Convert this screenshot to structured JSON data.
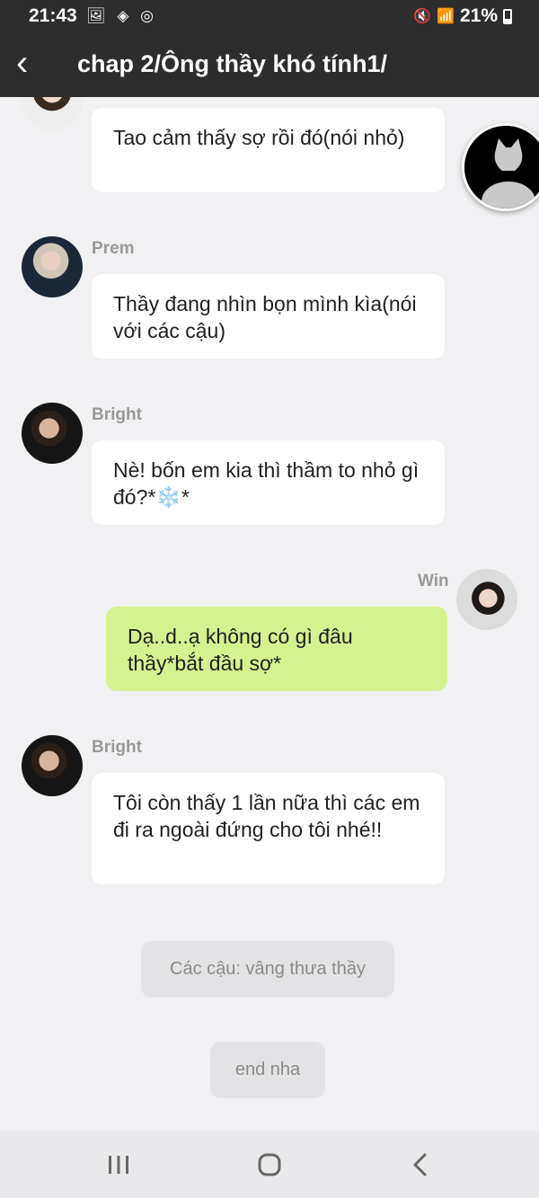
{
  "status_bar": {
    "time": "21:43",
    "left_icons": [
      "image-icon",
      "location-icon",
      "messenger-icon"
    ],
    "battery": "21%",
    "right_icons": [
      "mute-icon",
      "wifi-icon",
      "signal-icon",
      "battery-icon"
    ]
  },
  "header": {
    "title": "chap 2/Ông thầy khó tính1/",
    "back_icon": "chevron-left-icon"
  },
  "messages": [
    {
      "sender": "",
      "text": "Tao cảm thấy sợ rồi đó(nói nhỏ)",
      "side": "left"
    },
    {
      "sender": "Prem",
      "text": "Thầy đang nhìn bọn mình kìa(nói với các cậu)",
      "side": "left"
    },
    {
      "sender": "Bright",
      "text": "Nè! bốn em kia thì thầm to nhỏ gì đó?*❄️*",
      "side": "left"
    },
    {
      "sender": "Win",
      "text": "Dạ..d..ạ không có gì đâu thầy*bắt đầu sợ*",
      "side": "right"
    },
    {
      "sender": "Bright",
      "text": "Tôi còn thấy 1 lần nữa thì các em đi ra ngoài đứng cho tôi nhé!!",
      "side": "left"
    }
  ],
  "system_messages": [
    "Các cậu: vâng thưa thầy",
    "end nha"
  ],
  "nav": [
    "recent-apps-icon",
    "home-icon",
    "back-icon"
  ],
  "colors": {
    "header_bg": "#2d2d2d",
    "chat_bg": "#f1f1f3",
    "my_bubble": "#d6f18f",
    "bubble": "#ffffff"
  }
}
